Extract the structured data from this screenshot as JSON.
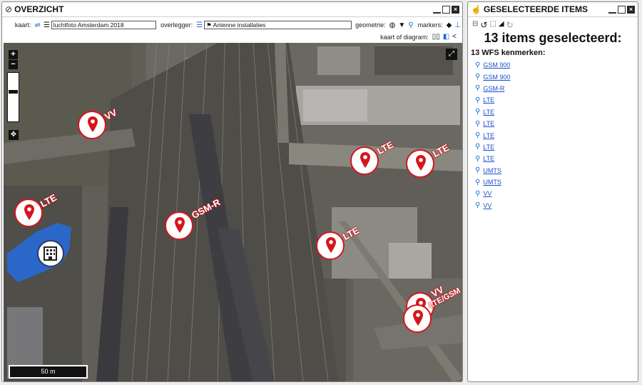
{
  "overview": {
    "title": "OVERZICHT",
    "kaart_label": "kaart:",
    "kaart_value": "luchtfoto Amsterdam 2018",
    "overlegger_label": "overlegger:",
    "overlegger_value": "Antenne installaties",
    "geometrie_label": "geometrie:",
    "markers_label": "markers:",
    "kaart_of_diagram_label": "kaart of diagram:",
    "scale_label": "50 m",
    "zoom_in": "+",
    "zoom_out": "−",
    "markers": [
      {
        "label": "VV"
      },
      {
        "label": "LTE"
      },
      {
        "label": "LTE"
      },
      {
        "label": "LTE"
      },
      {
        "label": "GSM-R"
      },
      {
        "label": "LTE"
      },
      {
        "label": "VV"
      },
      {
        "label": "LTE/GSM"
      }
    ]
  },
  "selected": {
    "title": "GESELECTEERDE ITEMS",
    "heading": "13 items geselecteerd:",
    "sub": "13 WFS kenmerken:",
    "items": [
      "GSM 900",
      "GSM 900",
      "GSM-R",
      "LTE",
      "LTE",
      "LTE",
      "LTE",
      "LTE",
      "LTE",
      "UMTS",
      "UMTS",
      "VV",
      "VV"
    ]
  }
}
